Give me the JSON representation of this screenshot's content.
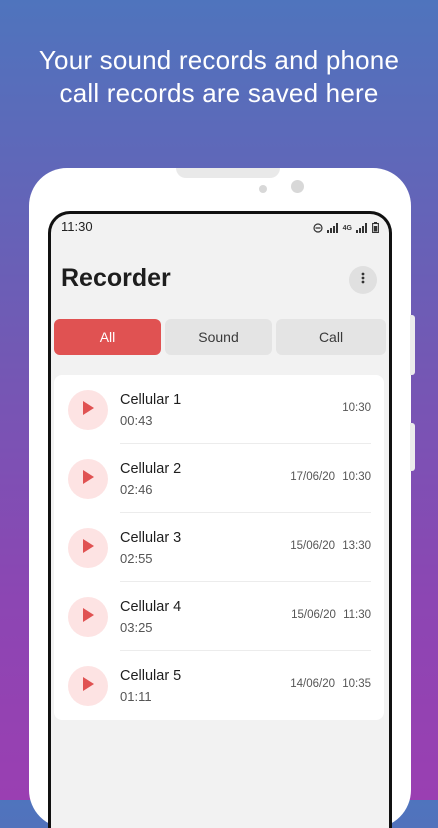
{
  "promo": {
    "line1": "Your sound records and phone",
    "line2": "call records are saved here"
  },
  "status_bar": {
    "time": "11:30",
    "icons": [
      "do-not-disturb-icon",
      "signal-icon",
      "4g-icon",
      "signal-icon",
      "battery-icon"
    ],
    "network_label": "4G"
  },
  "app": {
    "title": "Recorder",
    "more_icon": "more-vertical-icon",
    "accent_color": "#e05252"
  },
  "tabs": [
    {
      "label": "All",
      "active": true
    },
    {
      "label": "Sound",
      "active": false
    },
    {
      "label": "Call",
      "active": false
    }
  ],
  "recordings": [
    {
      "name": "Cellular 1",
      "duration": "00:43",
      "datetime": "10:30"
    },
    {
      "name": "Cellular 2",
      "duration": "02:46",
      "datetime": "17/06/20 10:30"
    },
    {
      "name": "Cellular 3",
      "duration": "02:55",
      "datetime": "15/06/20 13:30"
    },
    {
      "name": "Cellular 4",
      "duration": "03:25",
      "datetime": "15/06/20 11:30"
    },
    {
      "name": "Cellular 5",
      "duration": "01:11",
      "datetime": "14/06/20 10:35"
    }
  ]
}
